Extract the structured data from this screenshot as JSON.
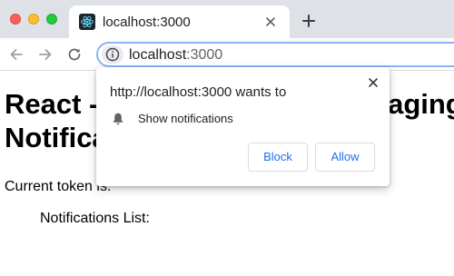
{
  "window": {
    "controls": [
      "close",
      "minimize",
      "maximize"
    ]
  },
  "tab": {
    "favicon": "react-logo-icon",
    "title": "localhost:3000",
    "close_icon": "close-icon"
  },
  "new_tab_icon": "plus-icon",
  "toolbar": {
    "back_icon": "arrow-left-icon",
    "forward_icon": "arrow-right-icon",
    "reload_icon": "reload-icon",
    "site_info_icon": "info-icon",
    "url_host": "localhost",
    "url_port": ":3000"
  },
  "page": {
    "heading": "React - Firebase Cloud Messaging Notifications",
    "token_label": "Current token is:",
    "list_heading": "Notifications List:"
  },
  "prompt": {
    "title": "http://localhost:3000 wants to",
    "permission_icon": "bell-icon",
    "permission_text": "Show notifications",
    "block_label": "Block",
    "allow_label": "Allow",
    "close_icon": "close-icon"
  },
  "colors": {
    "tabstrip_bg": "#dee1e6",
    "accent": "#1a73e8",
    "focus_ring": "#8ab4f8",
    "close_red": "#ff5f57",
    "minimize_yellow": "#febc2e",
    "maximize_green": "#28c840"
  }
}
